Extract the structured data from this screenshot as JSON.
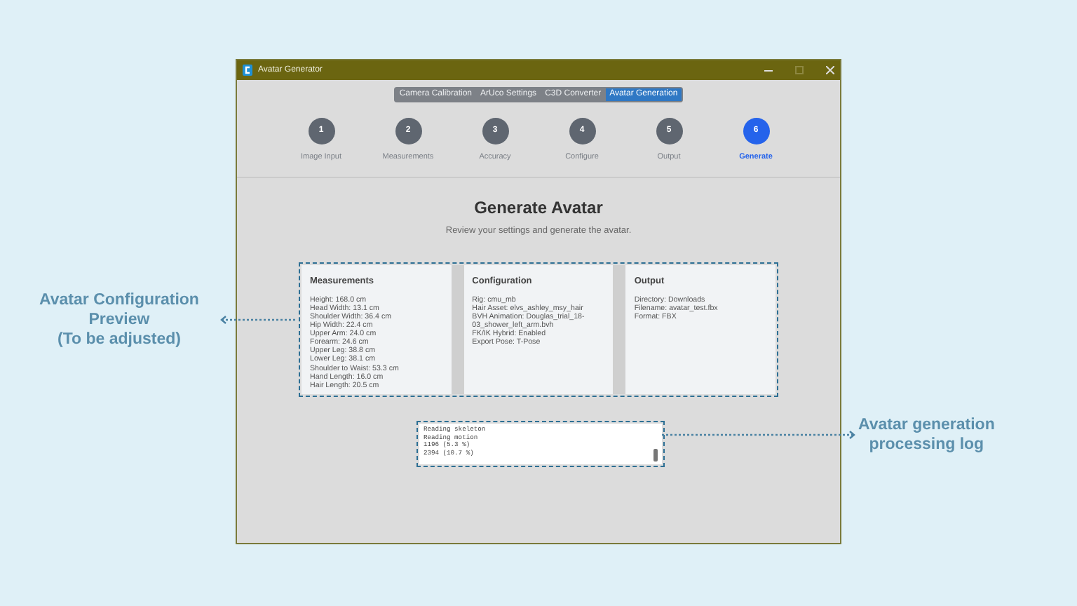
{
  "window": {
    "title": "Avatar Generator"
  },
  "tabs": [
    {
      "label": "Camera Calibration",
      "selected": false
    },
    {
      "label": "ArUco Settings",
      "selected": false
    },
    {
      "label": "C3D Converter",
      "selected": false
    },
    {
      "label": "Avatar Generation",
      "selected": true
    }
  ],
  "steps": [
    {
      "number": "1",
      "label": "Image Input",
      "selected": false
    },
    {
      "number": "2",
      "label": "Measurements",
      "selected": false
    },
    {
      "number": "3",
      "label": "Accuracy",
      "selected": false
    },
    {
      "number": "4",
      "label": "Configure",
      "selected": false
    },
    {
      "number": "5",
      "label": "Output",
      "selected": false
    },
    {
      "number": "6",
      "label": "Generate",
      "selected": true
    }
  ],
  "heading": "Generate Avatar",
  "subtitle": "Review your settings and generate the avatar.",
  "summary": [
    {
      "title": "Measurements",
      "lines": [
        "Height: 168.0 cm",
        "Head Width: 13.1 cm",
        "Shoulder Width: 36.4 cm",
        "Hip Width: 22.4 cm",
        "Upper Arm: 24.0 cm",
        "Forearm: 24.6 cm",
        "Upper Leg: 38.8 cm",
        "Lower Leg: 38.1 cm",
        "Shoulder to Waist: 53.3 cm",
        "Hand Length: 16.0 cm",
        "Hair Length: 20.5 cm"
      ]
    },
    {
      "title": "Configuration",
      "lines": [
        "Rig: cmu_mb",
        "Hair Asset: elvs_ashley_msy_hair",
        "BVH Animation: Douglas_trial_18-03_shower_left_arm.bvh",
        "FK/IK Hybrid: Enabled",
        "Export Pose: T-Pose"
      ]
    },
    {
      "title": "Output",
      "lines": [
        "Directory: Downloads",
        "Filename: avatar_test.fbx",
        "Format: FBX"
      ]
    }
  ],
  "log": {
    "lines": [
      "Reading skeleton",
      "Reading motion",
      "1196 (5.3 %)",
      "2394 (10.7 %)"
    ]
  },
  "annotations": [
    {
      "kind": "left",
      "lines": [
        "Avatar Configuration",
        "Preview",
        "(To be adjusted)"
      ]
    },
    {
      "kind": "right",
      "lines": [
        "Avatar generation",
        "processing log"
      ]
    }
  ]
}
